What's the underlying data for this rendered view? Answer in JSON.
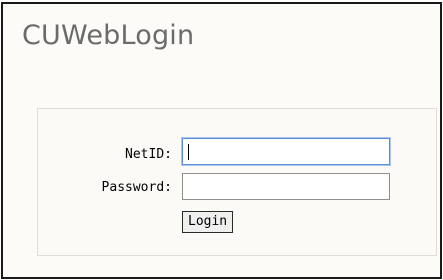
{
  "app": {
    "title": "CUWebLogin"
  },
  "form": {
    "netid_label": "NetID:",
    "netid_value": "",
    "password_label": "Password:",
    "password_value": "",
    "login_label": "Login"
  },
  "colors": {
    "title_text": "#6b6b6b",
    "focus_border": "#5b8fd8",
    "panel_border": "#e1ddd5"
  }
}
